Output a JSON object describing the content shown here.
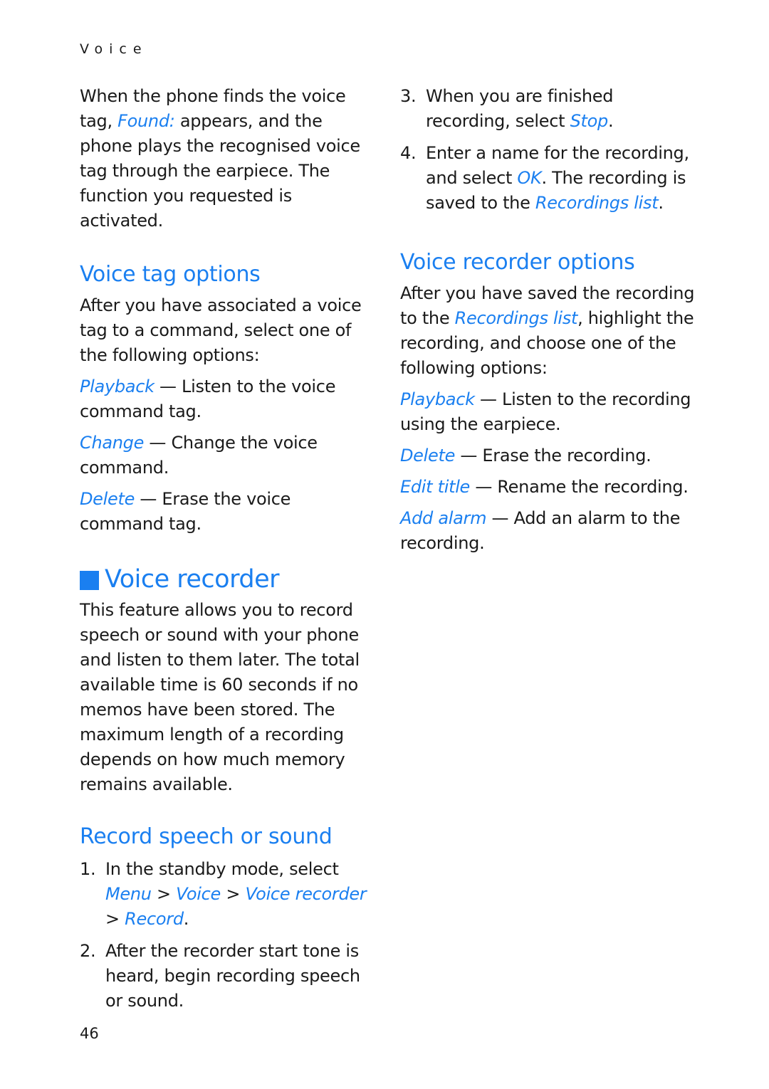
{
  "running_head": "Voice",
  "page_number": "46",
  "colors": {
    "accent": "#1a7ff0",
    "text": "#1a1a1a"
  },
  "left": {
    "intro": {
      "pre": "When the phone finds the voice tag, ",
      "link": "Found:",
      "post": " appears, and the phone plays the recognised voice tag through the earpiece. The function you requested is activated."
    },
    "voice_tag_options": {
      "heading": "Voice tag options",
      "intro": "After you have associated a voice tag to a command, select one of the following options:",
      "options": [
        {
          "term": "Playback",
          "desc": " — Listen to the voice command tag."
        },
        {
          "term": "Change",
          "desc": " — Change the voice command."
        },
        {
          "term": "Delete",
          "desc": " — Erase the voice command tag."
        }
      ]
    },
    "voice_recorder": {
      "icon": "square-bullet-icon",
      "heading": "Voice recorder",
      "body": "This feature allows you to record speech or sound with your phone and listen to them later. The total available time is 60 seconds if no memos have been stored. The maximum length of a recording depends on how much memory remains available."
    },
    "record_speech": {
      "heading": "Record speech or sound",
      "steps": [
        {
          "num": "1.",
          "text": "In the standby mode, select ",
          "path": [
            "Menu",
            "Voice",
            "Voice recorder",
            "Record"
          ],
          "sep": " > ",
          "end": "."
        },
        {
          "num": "2.",
          "text": "After the recorder start tone is heard, begin recording speech or sound."
        }
      ]
    }
  },
  "right": {
    "steps": [
      {
        "num": "3.",
        "pre": "When you are finished recording, select ",
        "link": "Stop",
        "post": "."
      },
      {
        "num": "4.",
        "pre": "Enter a name for the recording, and select ",
        "link": "OK",
        "mid": ". The recording is saved to the ",
        "link2": "Recordings list",
        "post": "."
      }
    ],
    "voice_recorder_options": {
      "heading": "Voice recorder options",
      "intro_pre": "After you have saved the recording to the ",
      "intro_link": "Recordings list",
      "intro_post": ", highlight the recording, and choose one of the following options:",
      "options": [
        {
          "term": "Playback",
          "desc": " — Listen to the recording using the earpiece."
        },
        {
          "term": "Delete",
          "desc": " — Erase the recording."
        },
        {
          "term": "Edit title",
          "desc": " — Rename the recording."
        },
        {
          "term": "Add alarm",
          "desc": " — Add an alarm to the recording."
        }
      ]
    }
  }
}
